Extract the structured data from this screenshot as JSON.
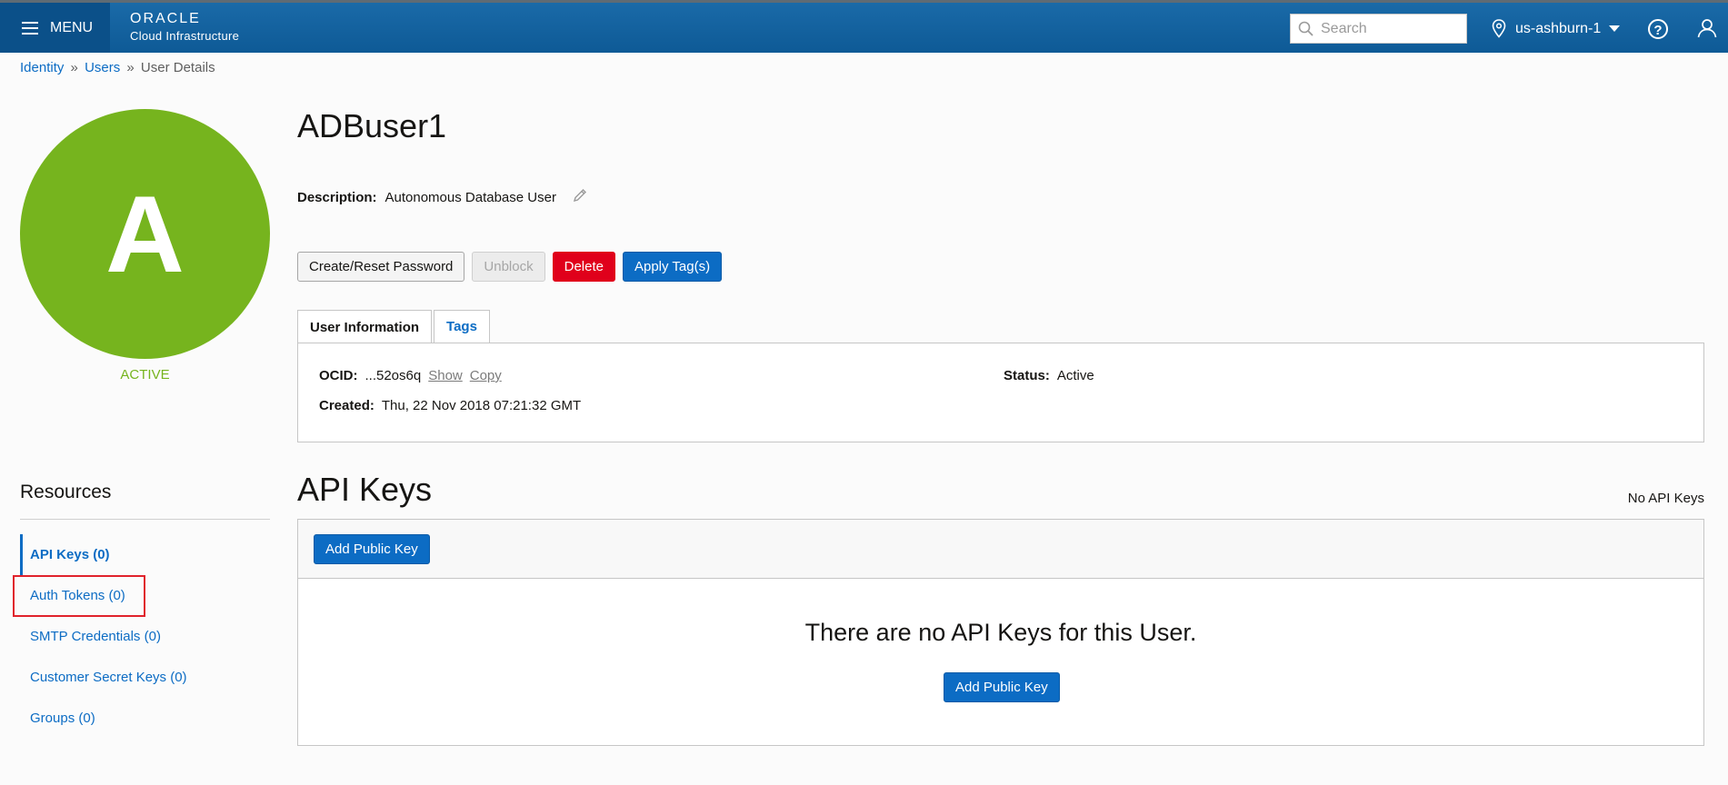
{
  "header": {
    "menu_label": "MENU",
    "brand_name": "ORACLE",
    "brand_sub": "Cloud Infrastructure",
    "search_placeholder": "Search",
    "region": "us-ashburn-1"
  },
  "breadcrumb": {
    "items": [
      "Identity",
      "Users",
      "User Details"
    ],
    "separator": "»"
  },
  "avatar": {
    "letter": "A",
    "status": "ACTIVE",
    "color": "#76b41e"
  },
  "user": {
    "name": "ADBuser1",
    "description_label": "Description:",
    "description": "Autonomous Database User"
  },
  "actions": {
    "create_reset_password": "Create/Reset Password",
    "unblock": "Unblock",
    "delete": "Delete",
    "apply_tags": "Apply Tag(s)"
  },
  "tabs": [
    "User Information",
    "Tags"
  ],
  "info": {
    "ocid_label": "OCID:",
    "ocid_value": "...52os6q",
    "show": "Show",
    "copy": "Copy",
    "created_label": "Created:",
    "created_value": "Thu, 22 Nov 2018 07:21:32 GMT",
    "status_label": "Status:",
    "status_value": "Active"
  },
  "resources": {
    "title": "Resources",
    "items": [
      "API Keys (0)",
      "Auth Tokens (0)",
      "SMTP Credentials (0)",
      "Customer Secret Keys (0)",
      "Groups (0)"
    ]
  },
  "api_keys": {
    "title": "API Keys",
    "count_text": "No API Keys",
    "add_button": "Add Public Key",
    "empty_message": "There are no API Keys for this User.",
    "empty_add_button": "Add Public Key"
  },
  "colors": {
    "header": "#0e5a96",
    "link": "#0c6cc4",
    "danger": "#e0001b",
    "highlight": "#e0222c"
  }
}
